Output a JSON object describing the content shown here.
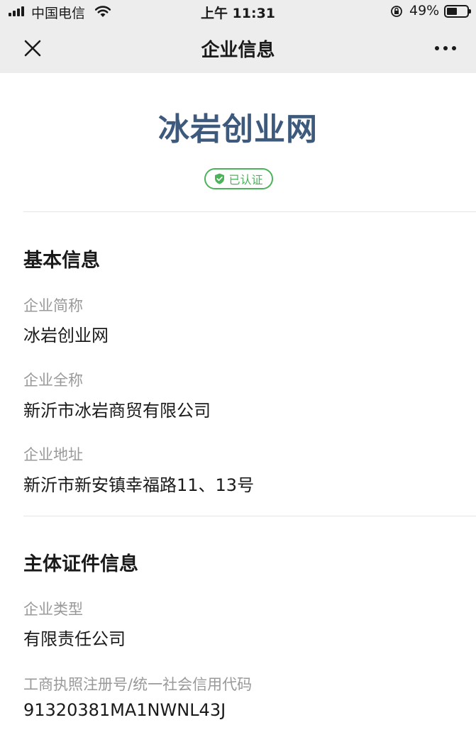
{
  "status_bar": {
    "carrier": "中国电信",
    "time": "上午 11:31",
    "battery": "49%"
  },
  "nav": {
    "title": "企业信息",
    "close_icon": "close-icon",
    "more_icon": "more-dots-icon"
  },
  "company": {
    "name": "冰岩创业网",
    "badge": "已认证"
  },
  "basic_info": {
    "title": "基本信息",
    "fields": [
      {
        "label": "企业简称",
        "value": "冰岩创业网"
      },
      {
        "label": "企业全称",
        "value": "新沂市冰岩商贸有限公司"
      },
      {
        "label": "企业地址",
        "value": "新沂市新安镇幸福路11、13号"
      }
    ]
  },
  "license_info": {
    "title": "主体证件信息",
    "fields": [
      {
        "label": "企业类型",
        "value": "有限责任公司"
      },
      {
        "label": "工商执照注册号/统一社会信用代码",
        "value": "91320381MA1NWNL43J"
      }
    ]
  },
  "colors": {
    "brand": "#3d5a7d",
    "verified": "#4cb35a",
    "label": "#999999"
  }
}
